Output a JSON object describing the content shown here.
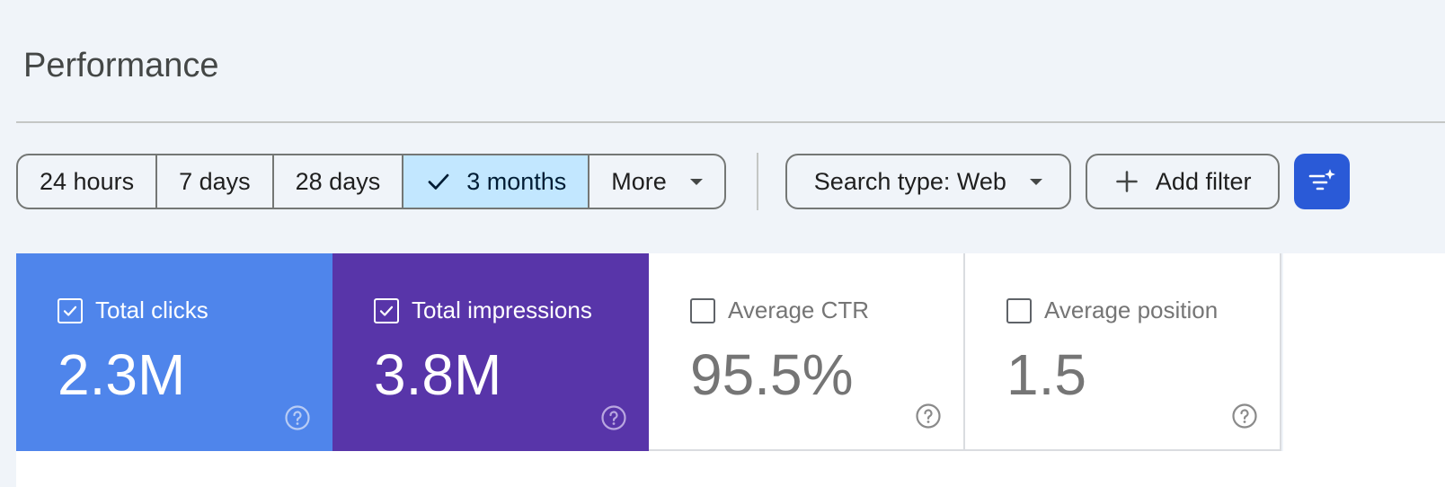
{
  "page": {
    "title": "Performance"
  },
  "date_range": {
    "options": [
      {
        "label": "24 hours",
        "active": false
      },
      {
        "label": "7 days",
        "active": false
      },
      {
        "label": "28 days",
        "active": false
      },
      {
        "label": "3 months",
        "active": true
      },
      {
        "label": "More",
        "active": false,
        "dropdown": true
      }
    ]
  },
  "filters": {
    "search_type_label": "Search type: Web",
    "add_filter_label": "Add filter",
    "ai_filter_icon": "sparkle-filter-icon"
  },
  "metrics": [
    {
      "label": "Total clicks",
      "value": "2.3M",
      "checked": true,
      "color": "#4f85eb"
    },
    {
      "label": "Total impressions",
      "value": "3.8M",
      "checked": true,
      "color": "#5835a9"
    },
    {
      "label": "Average CTR",
      "value": "95.5%",
      "checked": false,
      "color": "#ffffff"
    },
    {
      "label": "Average position",
      "value": "1.5",
      "checked": false,
      "color": "#ffffff"
    }
  ],
  "colors": {
    "background": "#f0f4f9",
    "active_segment": "#c2e7ff",
    "primary_button": "#2a5ad7"
  }
}
